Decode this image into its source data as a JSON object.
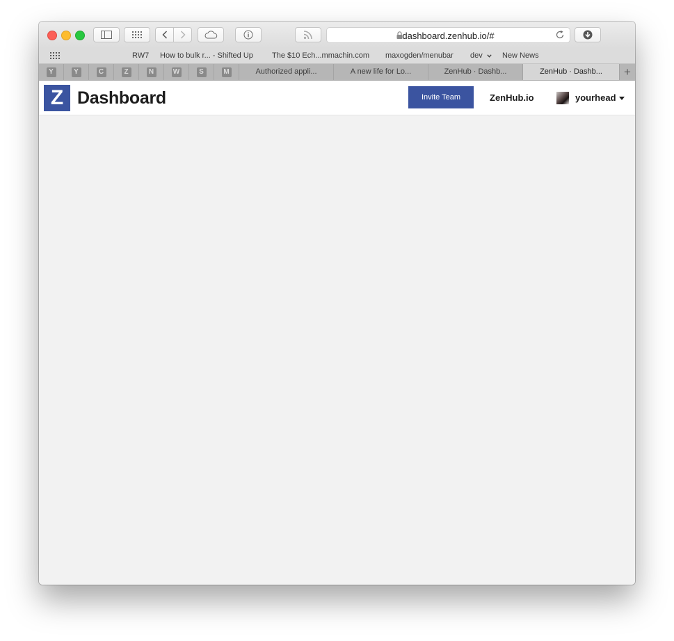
{
  "browser": {
    "url": "dashboard.zenhub.io/#",
    "bookmarks": [
      "RW7",
      "How to bulk r... - Shifted Up",
      "The $10 Ech...mmachin.com",
      "maxogden/menubar",
      "dev",
      "New News"
    ],
    "pinned_tabs": [
      "Y",
      "Y",
      "C",
      "Z",
      "N",
      "W",
      "S",
      "M"
    ],
    "tabs": [
      "Authorized appli...",
      "A new life for Lo...",
      "ZenHub · Dashb...",
      "ZenHub · Dashb..."
    ],
    "new_tab_label": "+"
  },
  "app": {
    "logo_letter": "Z",
    "title": "Dashboard",
    "invite_label": "Invite Team",
    "site_link": "ZenHub.io",
    "username": "yourhead",
    "accent_color": "#3b54a0"
  }
}
